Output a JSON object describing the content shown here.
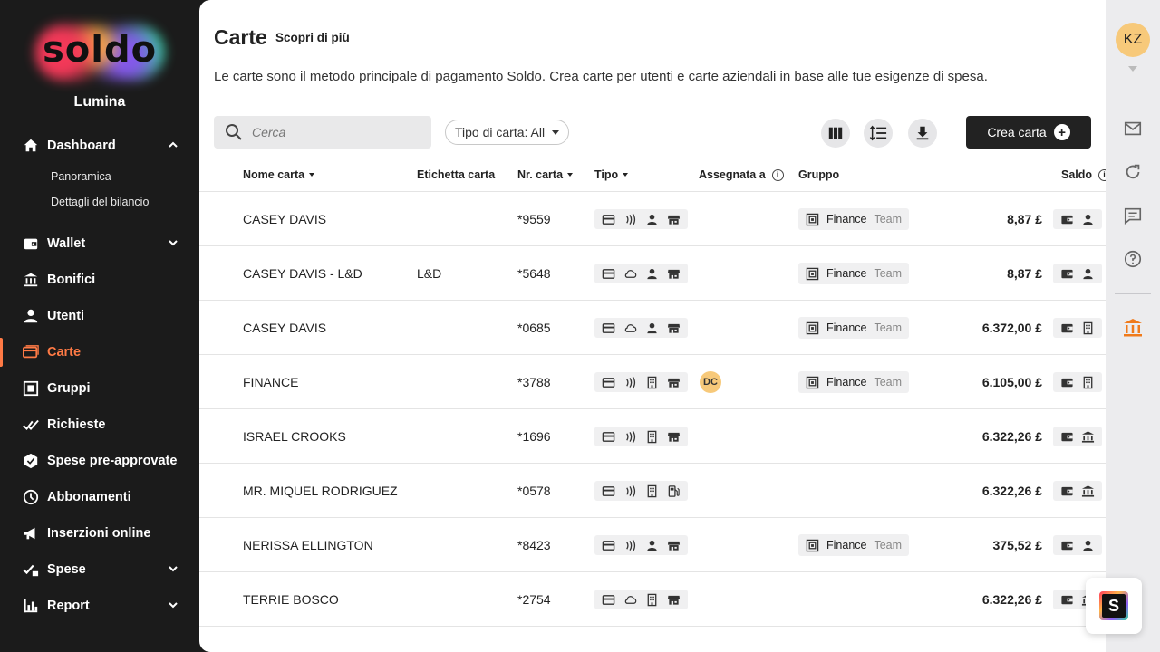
{
  "sidebar": {
    "logo_text": "soldo",
    "org_name": "Lumina",
    "items": [
      {
        "label": "Dashboard",
        "icon": "home-icon",
        "chevron": "up"
      },
      {
        "label": "Wallet",
        "icon": "wallet-icon",
        "chevron": "down"
      },
      {
        "label": "Bonifici",
        "icon": "bank-transfer-icon"
      },
      {
        "label": "Utenti",
        "icon": "user-icon"
      },
      {
        "label": "Carte",
        "icon": "cards-icon",
        "active": true
      },
      {
        "label": "Gruppi",
        "icon": "groups-icon"
      },
      {
        "label": "Richieste",
        "icon": "requests-icon"
      },
      {
        "label": "Spese pre-approvate",
        "icon": "pre-approved-icon"
      },
      {
        "label": "Abbonamenti",
        "icon": "clock-icon"
      },
      {
        "label": "Inserzioni online",
        "icon": "megaphone-icon"
      },
      {
        "label": "Spese",
        "icon": "expenses-icon",
        "chevron": "down"
      },
      {
        "label": "Report",
        "icon": "report-icon",
        "chevron": "down"
      }
    ],
    "dashboard_sub": [
      "Panoramica",
      "Dettagli del bilancio"
    ]
  },
  "header": {
    "title": "Carte",
    "learn_more": "Scopri di più",
    "description": "Le carte sono il metodo principale di pagamento Soldo. Crea carte per utenti e carte aziendali in base alle tue esigenze di spesa."
  },
  "toolbar": {
    "search_placeholder": "Cerca",
    "filter_label": "Tipo di carta: All",
    "create_label": "Crea carta"
  },
  "table": {
    "columns": [
      "Nome carta",
      "Etichetta carta",
      "Nr. carta",
      "Tipo",
      "Assegnata a",
      "Gruppo",
      "Saldo"
    ],
    "rows": [
      {
        "name": "CASEY DAVIS",
        "label": "",
        "number": "*9559",
        "types": [
          "card",
          "contactless",
          "user",
          "store"
        ],
        "assigned": "",
        "group": "Finance",
        "group_sub": "Team",
        "balance": "8,87 £",
        "wallet": [
          "wallet",
          "user"
        ]
      },
      {
        "name": "CASEY DAVIS - L&D",
        "label": "L&D",
        "number": "*5648",
        "types": [
          "card",
          "cloud",
          "user",
          "store"
        ],
        "assigned": "",
        "group": "Finance",
        "group_sub": "Team",
        "balance": "8,87 £",
        "wallet": [
          "wallet",
          "user"
        ]
      },
      {
        "name": "CASEY DAVIS",
        "label": "",
        "number": "*0685",
        "types": [
          "card",
          "cloud",
          "user",
          "store"
        ],
        "assigned": "",
        "group": "Finance",
        "group_sub": "Team",
        "balance": "6.372,00 £",
        "wallet": [
          "wallet",
          "company"
        ]
      },
      {
        "name": "FINANCE",
        "label": "",
        "number": "*3788",
        "types": [
          "card",
          "contactless",
          "company",
          "store"
        ],
        "assigned": "DC",
        "group": "Finance",
        "group_sub": "Team",
        "balance": "6.105,00 £",
        "wallet": [
          "wallet",
          "company"
        ]
      },
      {
        "name": "ISRAEL CROOKS",
        "label": "",
        "number": "*1696",
        "types": [
          "card",
          "contactless",
          "company",
          "store"
        ],
        "assigned": "",
        "group": "",
        "group_sub": "",
        "balance": "6.322,26 £",
        "wallet": [
          "wallet",
          "bank"
        ]
      },
      {
        "name": "MR. MIQUEL RODRIGUEZ",
        "label": "",
        "number": "*0578",
        "types": [
          "card",
          "contactless",
          "company",
          "fuel"
        ],
        "assigned": "",
        "group": "",
        "group_sub": "",
        "balance": "6.322,26 £",
        "wallet": [
          "wallet",
          "bank"
        ]
      },
      {
        "name": "NERISSA ELLINGTON",
        "label": "",
        "number": "*8423",
        "types": [
          "card",
          "contactless",
          "user",
          "store"
        ],
        "assigned": "",
        "group": "Finance",
        "group_sub": "Team",
        "balance": "375,52 £",
        "wallet": [
          "wallet",
          "user"
        ]
      },
      {
        "name": "TERRIE BOSCO",
        "label": "",
        "number": "*2754",
        "types": [
          "card",
          "cloud",
          "company",
          "store"
        ],
        "assigned": "",
        "group": "",
        "group_sub": "",
        "balance": "6.322,26 £",
        "wallet": [
          "wallet",
          "bank"
        ]
      }
    ]
  },
  "rail": {
    "avatar": "KZ",
    "icons": [
      "mail-icon",
      "refresh-icon",
      "chat-icon",
      "help-icon",
      "bank-icon"
    ]
  },
  "colors": {
    "accent": "#ff7a45",
    "sidebar_bg": "#1b1b1b",
    "rail_bg": "#ececee"
  }
}
